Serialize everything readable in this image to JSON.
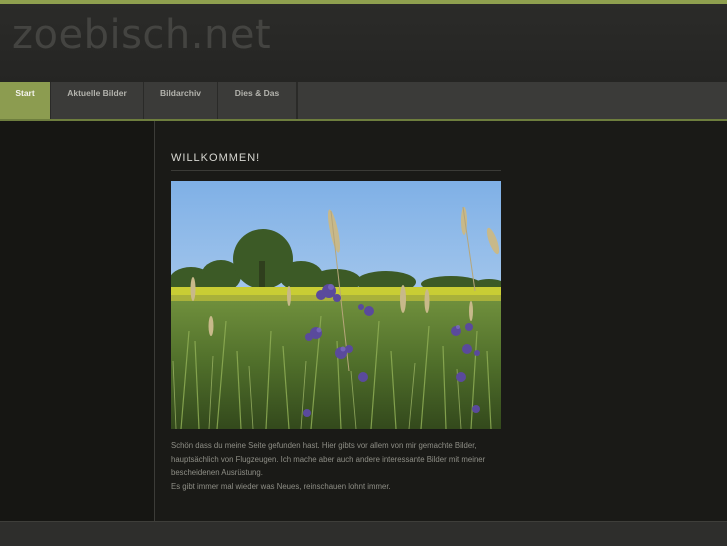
{
  "site": {
    "title": "zoebisch.net"
  },
  "nav": {
    "items": [
      {
        "label": "Start",
        "active": true
      },
      {
        "label": "Aktuelle Bilder",
        "active": false
      },
      {
        "label": "Bildarchiv",
        "active": false
      },
      {
        "label": "Dies & Das",
        "active": false
      }
    ]
  },
  "content": {
    "heading": "WILLKOMMEN!",
    "paragraph1": "Schön dass du meine Seite gefunden hast. Hier gibts vor allem von mir gemachte Bilder, hauptsächlich von Flugzeugen. Ich mache aber auch andere interessante Bilder mit meiner bescheidenen Ausrüstung.",
    "paragraph2": "Es gibt immer mal wieder was Neues, reinschauen lohnt immer."
  },
  "colors": {
    "accent": "#8c9c50",
    "background": "#1a1a17",
    "header": "#2b2b29"
  }
}
